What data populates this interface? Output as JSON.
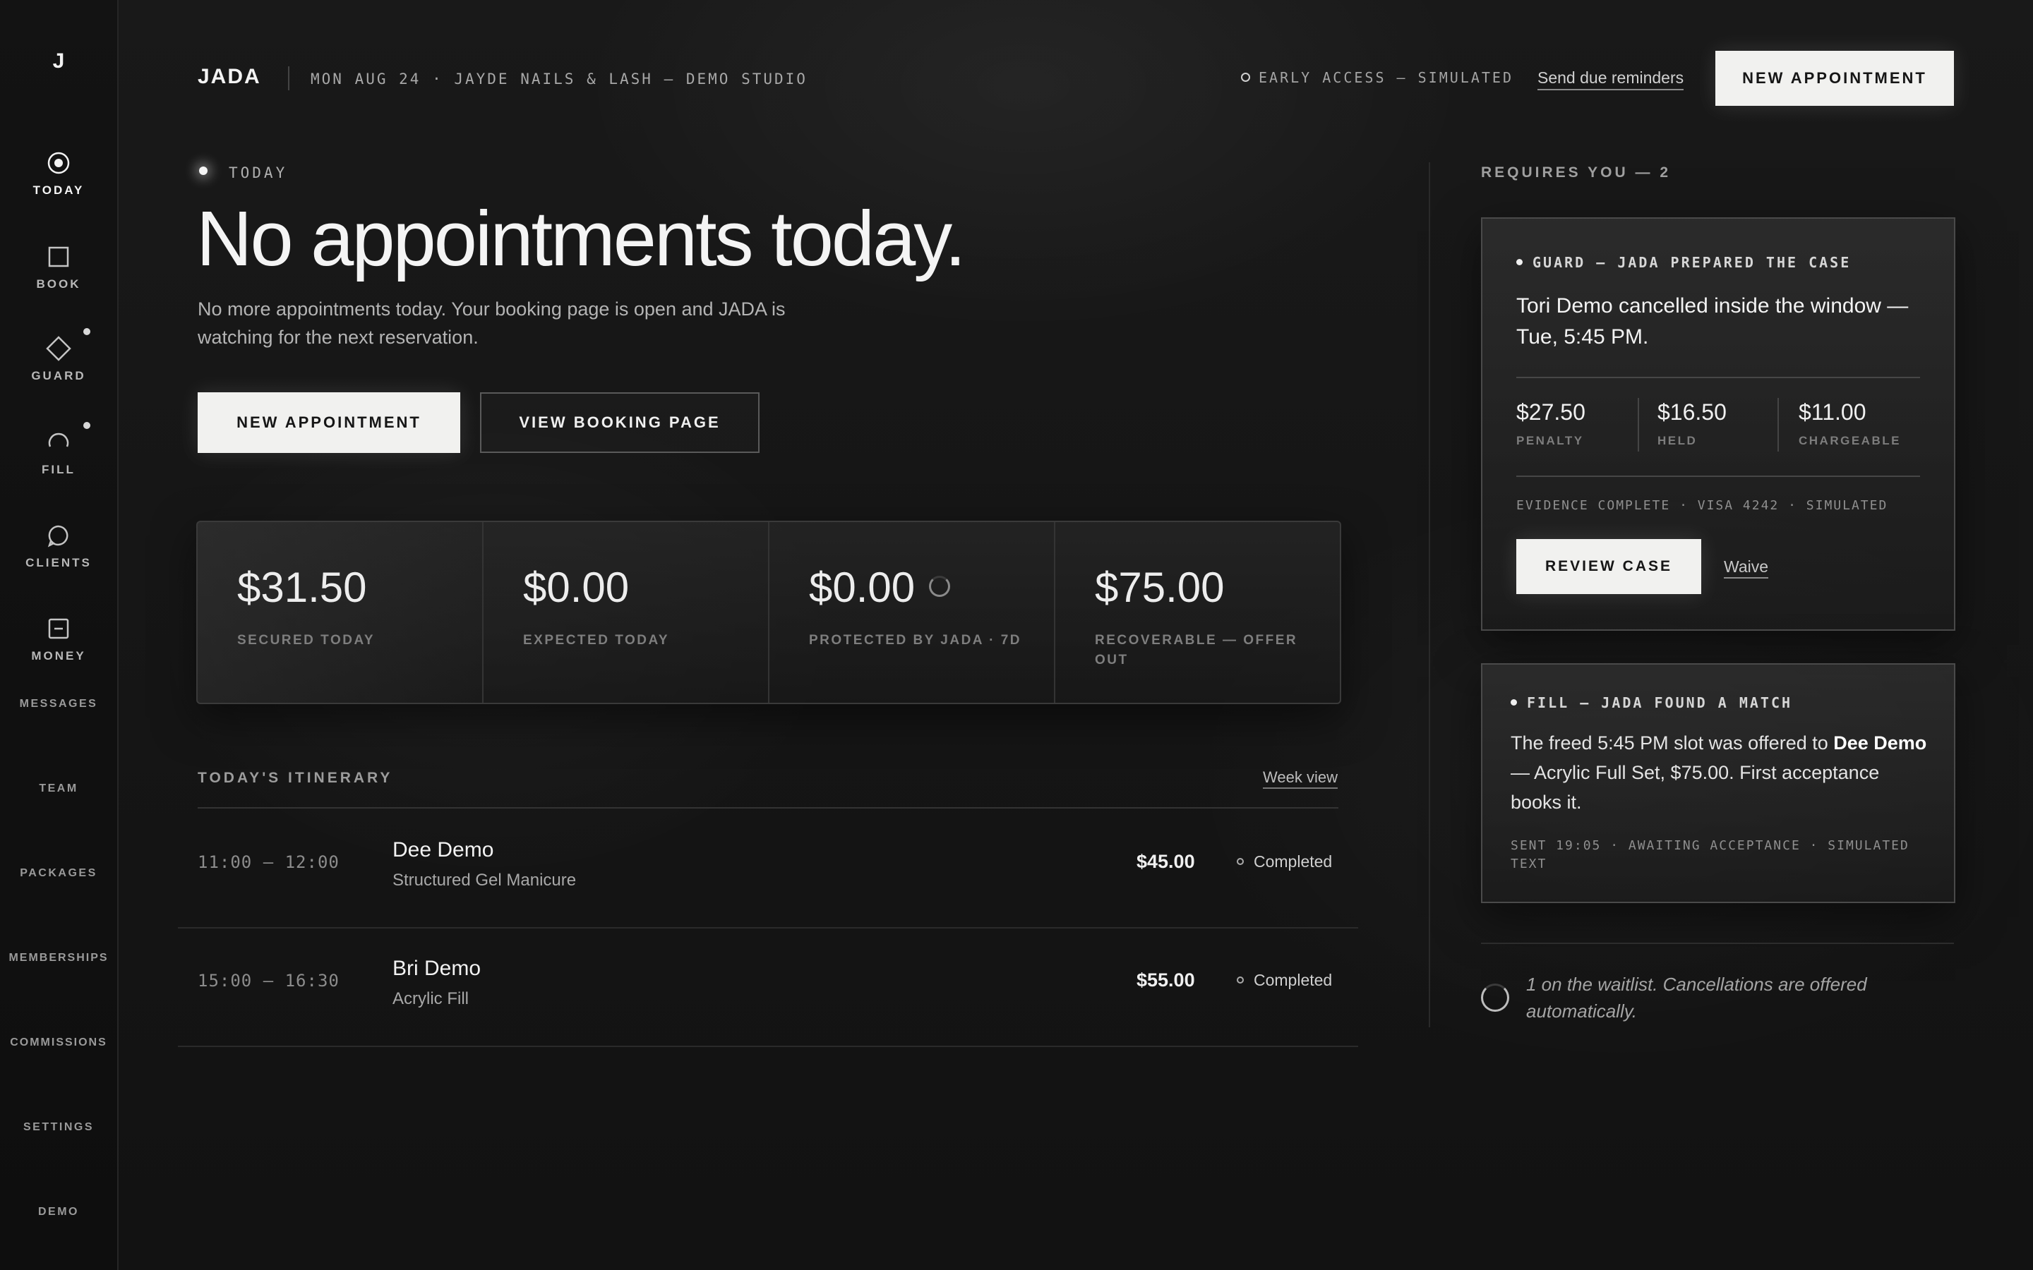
{
  "sidebar": {
    "logo": "J",
    "items": [
      {
        "label": "TODAY",
        "icon": "target-icon",
        "active": true
      },
      {
        "label": "BOOK",
        "icon": "square-icon"
      },
      {
        "label": "GUARD",
        "icon": "diamond-icon",
        "badge": true
      },
      {
        "label": "FILL",
        "icon": "arc-icon",
        "badge": true
      },
      {
        "label": "CLIENTS",
        "icon": "chat-bubble-icon"
      },
      {
        "label": "MONEY",
        "icon": "minus-box-icon"
      }
    ],
    "text_items": [
      "MESSAGES",
      "TEAM",
      "PACKAGES",
      "MEMBERSHIPS",
      "COMMISSIONS",
      "SETTINGS",
      "DEMO"
    ]
  },
  "header": {
    "brand": "JADA",
    "date_studio": "MON AUG 24 · JAYDE NAILS & LASH — DEMO STUDIO",
    "early_access": "EARLY ACCESS — SIMULATED",
    "reminders": "Send due reminders",
    "new_appointment": "NEW APPOINTMENT"
  },
  "hero": {
    "tag": "TODAY",
    "title": "No appointments today.",
    "subtitle": "No more appointments today. Your booking page is open and JADA is watching for the next reservation.",
    "primary_button": "NEW APPOINTMENT",
    "secondary_button": "VIEW BOOKING PAGE"
  },
  "stats": [
    {
      "value": "$31.50",
      "label": "SECURED TODAY"
    },
    {
      "value": "$0.00",
      "label": "EXPECTED TODAY"
    },
    {
      "value": "$0.00",
      "label": "PROTECTED BY JADA · 7D"
    },
    {
      "value": "$75.00",
      "label": "RECOVERABLE — OFFER OUT"
    }
  ],
  "itinerary": {
    "title": "TODAY'S ITINERARY",
    "week_view": "Week view",
    "rows": [
      {
        "time": "11:00 — 12:00",
        "name": "Dee Demo",
        "service": "Structured Gel Manicure",
        "price": "$45.00",
        "status": "Completed"
      },
      {
        "time": "15:00 — 16:30",
        "name": "Bri Demo",
        "service": "Acrylic Fill",
        "price": "$55.00",
        "status": "Completed"
      }
    ]
  },
  "requires": {
    "title": "REQUIRES YOU — 2",
    "guard_card": {
      "tag": "GUARD — JADA PREPARED THE CASE",
      "title": "Tori Demo cancelled inside the window — Tue, 5:45 PM.",
      "stats": [
        {
          "value": "$27.50",
          "label": "PENALTY"
        },
        {
          "value": "$16.50",
          "label": "HELD"
        },
        {
          "value": "$11.00",
          "label": "CHARGEABLE"
        }
      ],
      "meta": "EVIDENCE COMPLETE · VISA 4242 · SIMULATED",
      "review_button": "REVIEW CASE",
      "waive": "Waive"
    },
    "fill_card": {
      "tag": "FILL — JADA FOUND A MATCH",
      "text_before": "The freed 5:45 PM slot was offered to ",
      "client": "Dee Demo",
      "text_after": " — Acrylic Full Set, $75.00. First acceptance books it.",
      "meta": "SENT 19:05 · AWAITING ACCEPTANCE · SIMULATED TEXT"
    },
    "waitlist": "1 on the waitlist. Cancellations are offered automatically."
  }
}
